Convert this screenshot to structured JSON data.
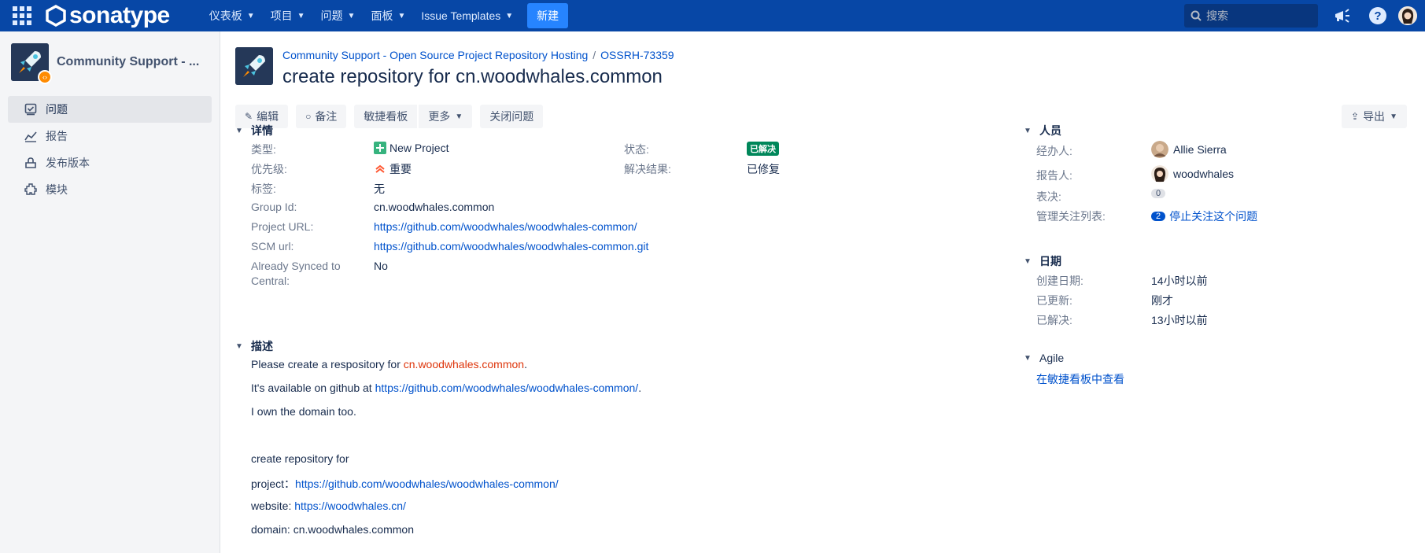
{
  "topnav": {
    "logo_text": "sonatype",
    "menu": [
      {
        "label": "仪表板"
      },
      {
        "label": "项目"
      },
      {
        "label": "问题"
      },
      {
        "label": "面板"
      },
      {
        "label": "Issue Templates"
      }
    ],
    "create_label": "新建",
    "search_placeholder": "搜索",
    "help_symbol": "?"
  },
  "sidebar": {
    "project_name": "Community Support - ...",
    "items": [
      {
        "label": "问题",
        "icon": "issues-icon",
        "active": true
      },
      {
        "label": "报告",
        "icon": "reports-icon"
      },
      {
        "label": "发布版本",
        "icon": "releases-icon"
      },
      {
        "label": "模块",
        "icon": "components-icon"
      }
    ]
  },
  "issue": {
    "breadcrumb_project": "Community Support - Open Source Project Repository Hosting",
    "breadcrumb_sep": "/",
    "breadcrumb_key": "OSSRH-73359",
    "title": "create repository for cn.woodwhales.common"
  },
  "toolbar": {
    "edit": "编辑",
    "comment": "备注",
    "agile_board": "敏捷看板",
    "more": "更多",
    "close_issue": "关闭问题",
    "export": "导出"
  },
  "details": {
    "heading": "详情",
    "type_label": "类型:",
    "type_value": "New Project",
    "priority_label": "优先级:",
    "priority_value": "重要",
    "labels_label": "标签:",
    "labels_value": "无",
    "group_id_label": "Group Id:",
    "group_id_value": "cn.woodwhales.common",
    "project_url_label": "Project URL:",
    "project_url_value": "https://github.com/woodwhales/woodwhales-common/",
    "scm_url_label": "SCM url:",
    "scm_url_value": "https://github.com/woodwhales/woodwhales-common.git",
    "synced_label_1": "Already Synced to",
    "synced_label_2": "Central:",
    "synced_value": "No",
    "status_label": "状态:",
    "status_value": "已解决",
    "status_color": "#00875a",
    "resolution_label": "解决结果:",
    "resolution_value": "已修复"
  },
  "description": {
    "heading": "描述",
    "line1_prefix": "Please create a respository for ",
    "line1_highlight": "cn.woodwhales.common",
    "line1_suffix": ".",
    "line2_prefix": "It's available on github at ",
    "line2_link": "https://github.com/woodwhales/woodwhales-common/",
    "line2_suffix": ".",
    "line3": "I own the domain too.",
    "line4": "create repository for",
    "line5_prefix": "project：",
    "line5_link": "https://github.com/woodwhales/woodwhales-common/",
    "line6_prefix": "website: ",
    "line6_link": "https://woodwhales.cn/",
    "line7": "domain: cn.woodwhales.common"
  },
  "people": {
    "heading": "人员",
    "assignee_label": "经办人:",
    "assignee_value": "Allie Sierra",
    "reporter_label": "报告人:",
    "reporter_value": "woodwhales",
    "votes_label": "表决:",
    "votes_value": "0",
    "watchers_label": "管理关注列表:",
    "watchers_count": "2",
    "watchers_link": "停止关注这个问题"
  },
  "dates": {
    "heading": "日期",
    "created_label": "创建日期:",
    "created_value": "14小时以前",
    "updated_label": "已更新:",
    "updated_value": "刚才",
    "resolved_label": "已解决:",
    "resolved_value": "13小时以前"
  },
  "agile": {
    "heading": "Agile",
    "link": "在敏捷看板中查看"
  }
}
